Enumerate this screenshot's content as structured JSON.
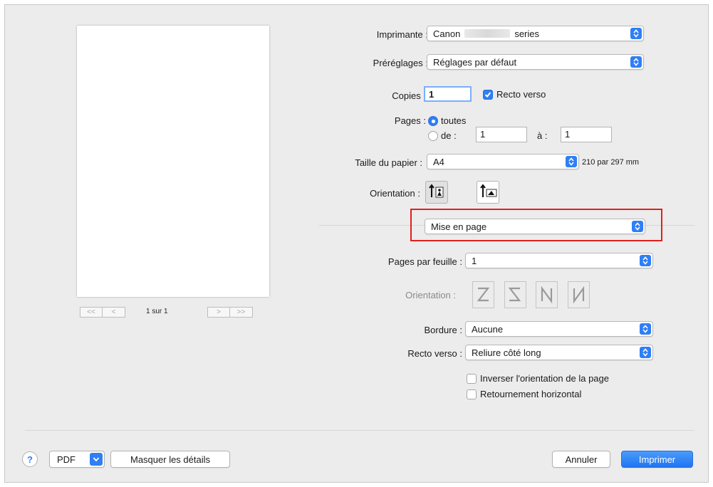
{
  "printer": {
    "label": "Imprimante :",
    "value_prefix": "Canon",
    "value_suffix": "series"
  },
  "presets": {
    "label": "Préréglages :",
    "value": "Réglages par défaut"
  },
  "copies": {
    "label": "Copies :",
    "value": "1",
    "duplex_label": "Recto verso",
    "duplex_checked": true
  },
  "pages": {
    "label": "Pages :",
    "all_label": "toutes",
    "from_label": "de :",
    "from_value": "1",
    "to_label": "à :",
    "to_value": "1"
  },
  "paper_size": {
    "label": "Taille du papier :",
    "value": "A4",
    "dimensions": "210 par 297 mm"
  },
  "orientation": {
    "label": "Orientation :"
  },
  "section_popup": {
    "value": "Mise en page"
  },
  "layout": {
    "pages_per_sheet_label": "Pages par feuille :",
    "pages_per_sheet_value": "1",
    "direction_label": "Orientation :",
    "direction_icons": [
      "Z",
      "S",
      "N-reversed",
      "N"
    ],
    "border_label": "Bordure :",
    "border_value": "Aucune",
    "two_sided_label": "Recto verso :",
    "two_sided_value": "Reliure côté long",
    "reverse_orientation_label": "Inverser l'orientation de la page",
    "reverse_orientation_checked": false,
    "flip_horizontal_label": "Retournement horizontal",
    "flip_horizontal_checked": false
  },
  "preview": {
    "page_indicator": "1 sur 1",
    "first_label": "<<",
    "prev_label": "<",
    "next_label": ">",
    "last_label": ">>"
  },
  "footer": {
    "help_label": "?",
    "pdf_label": "PDF",
    "details_label": "Masquer les détails",
    "cancel_label": "Annuler",
    "print_label": "Imprimer"
  },
  "colors": {
    "accent": "#2f7ff6",
    "highlight": "#e0201c",
    "dialog_bg": "#ececec"
  }
}
